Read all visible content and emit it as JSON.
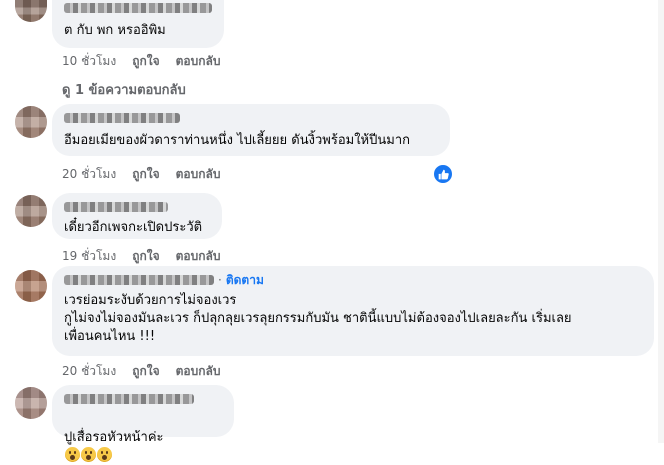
{
  "comments": [
    {
      "text": "ต กับ พก หรออิพิม",
      "time": "10 ชั่วโมง",
      "like": "ถูกใจ",
      "reply": "ตอบกลับ",
      "replies_link": "ดู 1 ข้อความตอบกลับ"
    },
    {
      "text": "อีมอยเมียของผัวดาราท่านหนึ่ง ไปเลี้ยยย ดันงิ้วพร้อมให้ปีนมาก",
      "time": "20 ชั่วโมง",
      "like": "ถูกใจ",
      "reply": "ตอบกลับ"
    },
    {
      "text": "เดี๋ยวอีกเพจกะเปิดประวัติ",
      "time": "19 ชั่วโมง",
      "like": "ถูกใจ",
      "reply": "ตอบกลับ"
    },
    {
      "follow": "ติดตาม",
      "text": "เวรย่อมระงับด้วยการไม่จองเวร\nกูไม่จงไม่จองมันละเวร ก็ปลุกลุยเวรลุยกรรมกับมัน ชาตินี้แบบไม่ต้องจองไปเลยละกัน เริ่มเลย\nเพื่อนคนไหน !!!",
      "time": "20 ชั่วโมง",
      "like": "ถูกใจ",
      "reply": "ตอบกลับ"
    },
    {
      "text": "ปูเสื่อรอหัวหน้าค่ะ"
    }
  ]
}
